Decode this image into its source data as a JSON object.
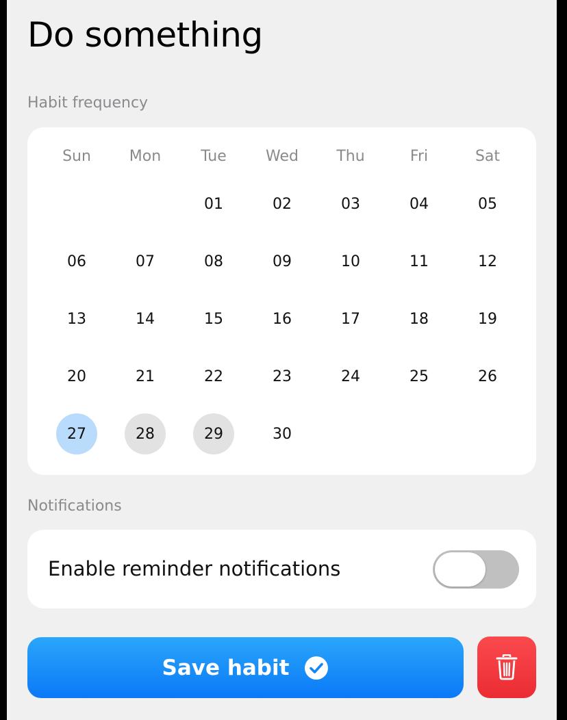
{
  "title": "Do something",
  "frequency": {
    "section_label": "Habit frequency",
    "weekdays": [
      "Sun",
      "Mon",
      "Tue",
      "Wed",
      "Thu",
      "Fri",
      "Sat"
    ],
    "weeks": [
      [
        "",
        "",
        "01",
        "02",
        "03",
        "04",
        "05"
      ],
      [
        "06",
        "07",
        "08",
        "09",
        "10",
        "11",
        "12"
      ],
      [
        "13",
        "14",
        "15",
        "16",
        "17",
        "18",
        "19"
      ],
      [
        "20",
        "21",
        "22",
        "23",
        "24",
        "25",
        "26"
      ],
      [
        "27",
        "28",
        "29",
        "30",
        "",
        "",
        ""
      ]
    ],
    "today": "27",
    "marked_days": [
      "28",
      "29"
    ],
    "colors": {
      "today": "#b9dcfd",
      "marked": "#e2e2e2"
    }
  },
  "notifications": {
    "section_label": "Notifications",
    "reminder_label": "Enable reminder notifications",
    "reminder_enabled": false
  },
  "actions": {
    "save_label": "Save habit",
    "save_icon": "checkmark-circle-icon",
    "delete_icon": "trash-icon",
    "colors": {
      "save": "#1a8ff9",
      "delete": "#f23a3f"
    }
  }
}
